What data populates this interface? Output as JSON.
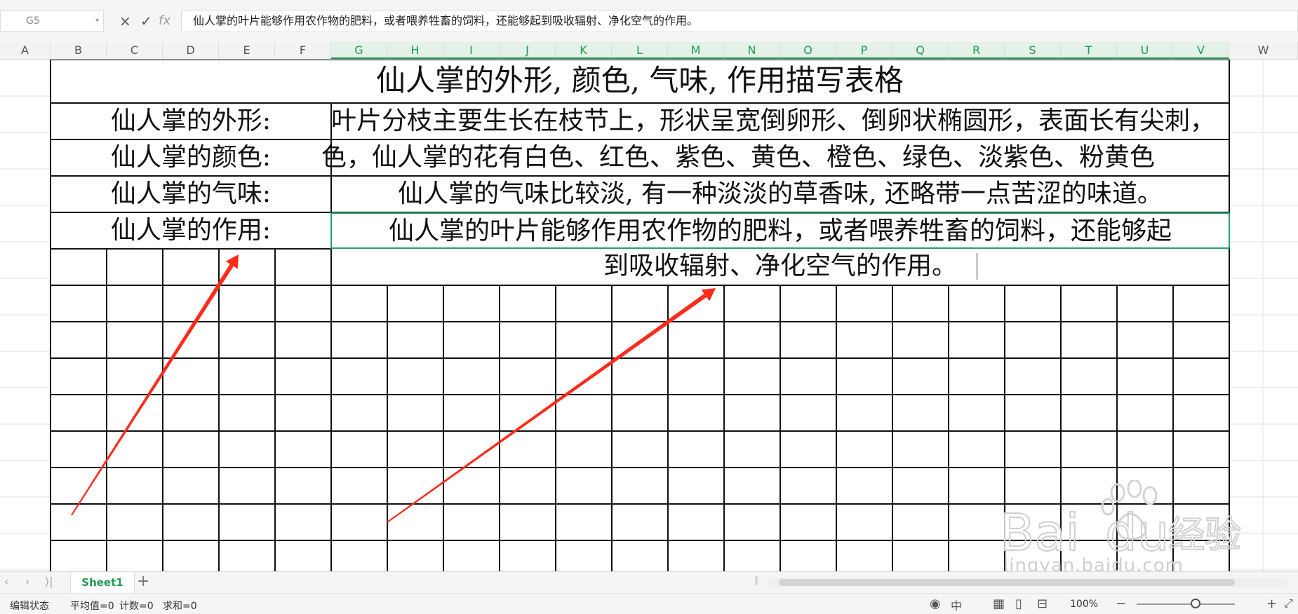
{
  "formula_bar": {
    "name_box": "G5",
    "cancel_icon": "×",
    "confirm_icon": "✓",
    "fx_icon": "fx",
    "content": "仙人掌的叶片能够作用农作物的肥料，或者喂养牲畜的饲料，还能够起到吸收辐射、净化空气的作用。"
  },
  "columns": [
    "A",
    "B",
    "C",
    "D",
    "E",
    "F",
    "G",
    "H",
    "I",
    "J",
    "K",
    "L",
    "M",
    "N",
    "O",
    "P",
    "Q",
    "R",
    "S",
    "T",
    "U",
    "V",
    "W"
  ],
  "selected_columns": [
    "G",
    "H",
    "I",
    "J",
    "K",
    "L",
    "M",
    "N",
    "O",
    "P",
    "Q",
    "R",
    "S",
    "T",
    "U",
    "V"
  ],
  "table": {
    "title": "仙人掌的外形, 颜色, 气味, 作用描写表格",
    "rows": [
      {
        "label": "仙人掌的外形:",
        "value": "叶片分枝主要生长在枝节上，形状呈宽倒卵形、倒卵状椭圆形，表面长有尖刺，"
      },
      {
        "label": "仙人掌的颜色:",
        "value": "色，仙人掌的花有白色、红色、紫色、黄色、橙色、绿色、淡紫色、粉黄色"
      },
      {
        "label": "仙人掌的气味:",
        "value": "仙人掌的气味比较淡, 有一种淡淡的草香味, 还略带一点苦涩的味道。"
      },
      {
        "label": "仙人掌的作用:",
        "value_line1": "仙人掌的叶片能够作用农作物的肥料，或者喂养牲畜的饲料，还能够起",
        "value_line2": "到吸收辐射、净化空气的作用。"
      }
    ]
  },
  "annotation_color": "#ff2a1a",
  "tabs": {
    "sheet_name": "Sheet1",
    "add_icon": "+",
    "nav_first": "‹",
    "nav_prev": "›",
    "nav_last": "⟩|"
  },
  "status": {
    "mode": "编辑状态",
    "average": "平均值=0",
    "count": "计数=0",
    "sum": "求和=0",
    "zoom": "100%",
    "zoom_minus": "−",
    "zoom_plus": "+"
  },
  "watermark": {
    "brand": "Bai",
    "brand2": "du",
    "brand_cn": "经验",
    "url": "jingyan.baidu.com"
  }
}
